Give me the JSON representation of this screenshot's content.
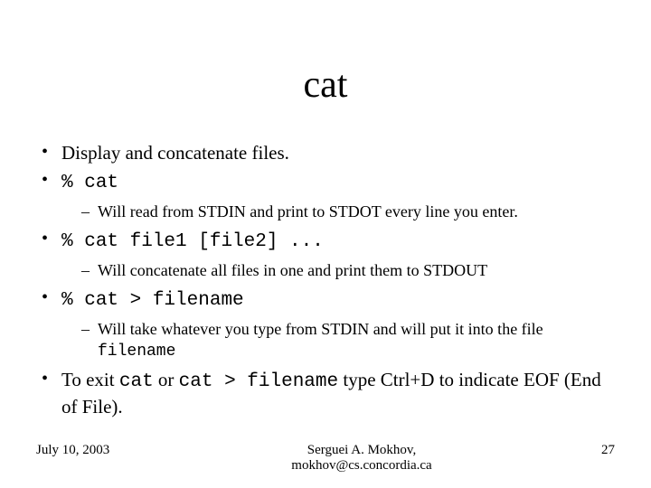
{
  "title": "cat",
  "b1": "Display and concatenate files.",
  "b2_prompt": "% ",
  "b2_cmd": "cat",
  "s2": "Will read from STDIN and print to STDOT every line you enter.",
  "b3_prompt": "% ",
  "b3_cmd": "cat file1 [file2] ...",
  "s3": "Will concatenate all files in one and print them to STDOUT",
  "b4_prompt": "% ",
  "b4_cmd": "cat > filename",
  "s4_a": "Will take whatever you type from STDIN and will put it into the file ",
  "s4_b": "filename",
  "b5_a": "To exit ",
  "b5_b": "cat",
  "b5_c": " or ",
  "b5_d": "cat > filename",
  "b5_e": " type Ctrl+D to indicate EOF (End of File).",
  "footer": {
    "date": "July 10, 2003",
    "author": "Serguei A. Mokhov,",
    "email": "mokhov@cs.concordia.ca",
    "page": "27"
  }
}
